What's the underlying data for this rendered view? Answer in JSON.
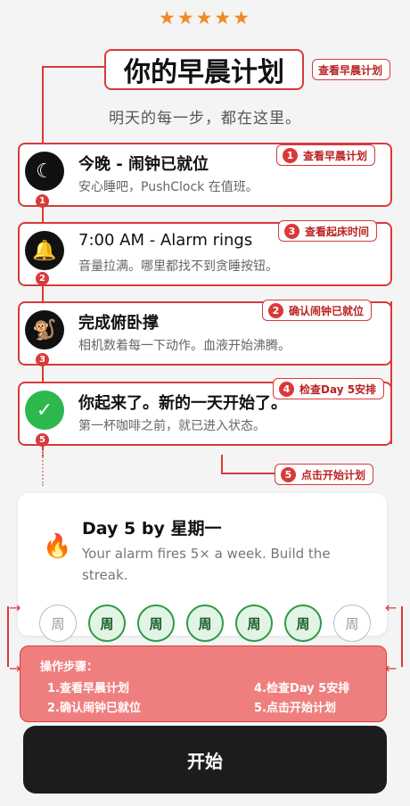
{
  "rating": {
    "stars": "★★★★★"
  },
  "header": {
    "title": "你的早晨计划",
    "subtitle": "明天的每一步，都在这里。"
  },
  "steps": [
    {
      "title": "今晚 - 闹钟已就位",
      "desc": "安心睡吧，PushClock 在值班。",
      "icon": "moon-icon",
      "marker": "1"
    },
    {
      "title": "7:00 AM - Alarm rings",
      "desc": "音量拉满。哪里都找不到贪睡按钮。",
      "icon": "bell-icon",
      "marker": "2"
    },
    {
      "title": "完成俯卧撑",
      "desc": "相机数着每一下动作。血液开始沸腾。",
      "icon": "pushup-avatar-icon",
      "marker": "3"
    },
    {
      "title": "你起来了。新的一天开始了。",
      "desc": "第一杯咖啡之前，就已进入状态。",
      "icon": "checkmark-icon",
      "marker": "5"
    }
  ],
  "callouts": {
    "title_tag": "查看早晨计划",
    "c1": {
      "num": "1",
      "label": "查看早晨计划"
    },
    "c3": {
      "num": "3",
      "label": "查看起床时间"
    },
    "c2": {
      "num": "2",
      "label": "确认闹钟已就位"
    },
    "c4": {
      "num": "4",
      "label": "检查Day 5安排"
    },
    "c5": {
      "num": "5",
      "label": "点击开始计划"
    }
  },
  "streak_card": {
    "title": "Day 5 by 星期一",
    "desc": "Your alarm fires 5× a week. Build the streak.",
    "icon": "fire-icon"
  },
  "days": [
    {
      "label": "周",
      "active": false
    },
    {
      "label": "周",
      "active": true
    },
    {
      "label": "周",
      "active": true
    },
    {
      "label": "周",
      "active": true
    },
    {
      "label": "周",
      "active": true
    },
    {
      "label": "周",
      "active": true
    },
    {
      "label": "周",
      "active": false
    }
  ],
  "guide": {
    "title": "操作步骤：",
    "s1": "1.查看早晨计划",
    "s2": "2.确认闹钟已就位",
    "s4": "4.检查Day 5安排",
    "s5": "5.点击开始计划"
  },
  "start_button": {
    "label": "开始"
  },
  "colors": {
    "accent": "#d83a3a",
    "success": "#2db84d",
    "button": "#1c1c1c"
  }
}
